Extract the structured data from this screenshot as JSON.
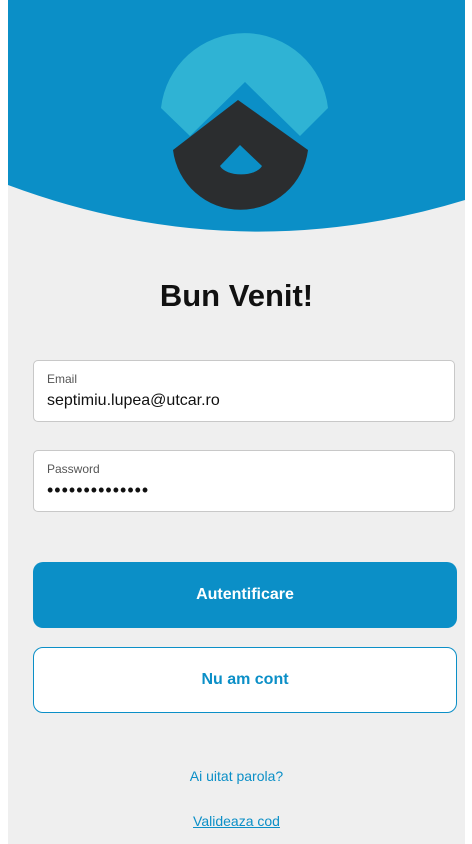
{
  "colors": {
    "accent": "#0b8fc7",
    "logo_top": "#2fb3d4",
    "logo_bottom": "#2b2d2f",
    "background": "#efefef"
  },
  "logo": {
    "icon": "app-logo-icon"
  },
  "welcome": {
    "title": "Bun Venit!"
  },
  "form": {
    "email": {
      "label": "Email",
      "value": "septimiu.lupea@utcar.ro"
    },
    "password": {
      "label": "Password",
      "value": "••••••••••••••"
    }
  },
  "buttons": {
    "login": "Autentificare",
    "no_account": "Nu am cont"
  },
  "links": {
    "forgot_password": "Ai uitat parola?",
    "validate_code": "Valideaza cod"
  }
}
